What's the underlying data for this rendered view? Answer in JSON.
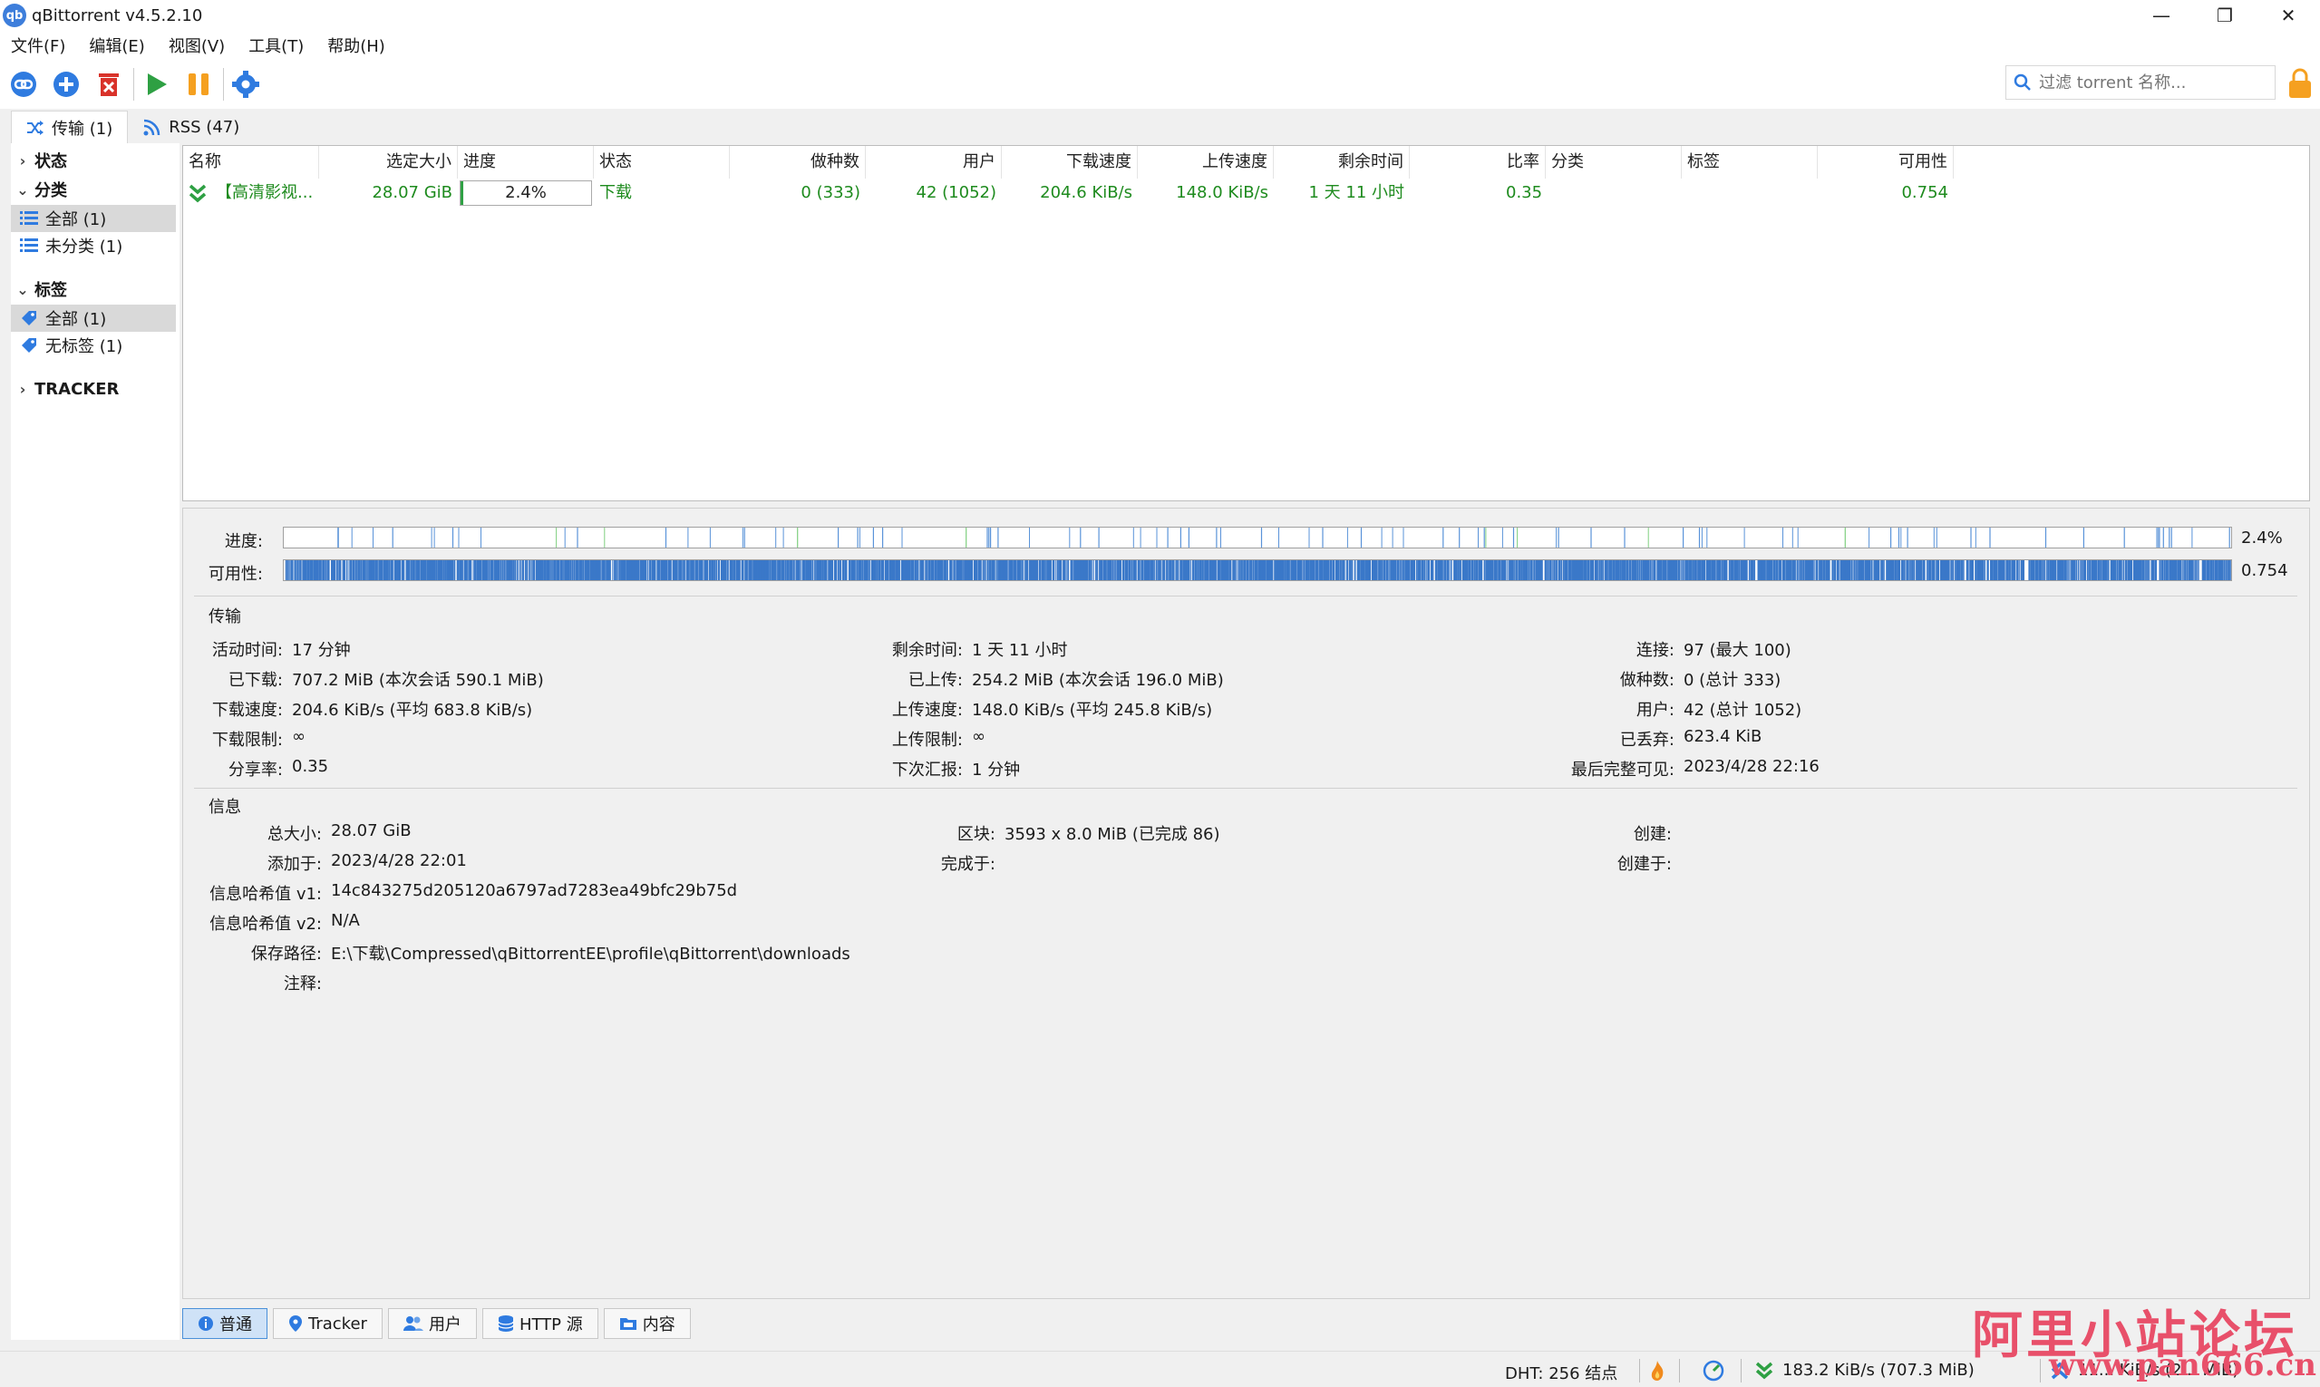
{
  "window": {
    "title": "qBittorrent v4.5.2.10",
    "icon_text": "qb"
  },
  "menu": [
    "文件(F)",
    "编辑(E)",
    "视图(V)",
    "工具(T)",
    "帮助(H)"
  ],
  "search": {
    "placeholder": "过滤 torrent 名称..."
  },
  "top_tabs": [
    {
      "label": "传输 (1)"
    },
    {
      "label": "RSS (47)"
    }
  ],
  "sidebar": {
    "status_header": "状态",
    "category_header": "分类",
    "category_items": [
      "全部 (1)",
      "未分类 (1)"
    ],
    "tag_header": "标签",
    "tag_items": [
      "全部 (1)",
      "无标签 (1)"
    ],
    "tracker_header": "TRACKER"
  },
  "table": {
    "columns": [
      "名称",
      "选定大小",
      "进度",
      "状态",
      "做种数",
      "用户",
      "下载速度",
      "上传速度",
      "剩余时间",
      "比率",
      "分类",
      "标签",
      "可用性"
    ],
    "row": {
      "name": "【高清影视...",
      "size": "28.07 GiB",
      "progress_text": "2.4%",
      "progress": 0.024,
      "status": "下载",
      "seeds": "0 (333)",
      "peers": "42 (1052)",
      "dl_speed": "204.6 KiB/s",
      "ul_speed": "148.0 KiB/s",
      "eta": "1 天 11 小时",
      "ratio": "0.35",
      "category": "",
      "tags": "",
      "availability": "0.754"
    }
  },
  "bars": {
    "progress_label": "进度:",
    "progress_value": "2.4%",
    "availability_label": "可用性:",
    "availability_value": "0.754"
  },
  "transfer": {
    "title": "传输",
    "col1": [
      {
        "label": "活动时间:",
        "value": "17 分钟"
      },
      {
        "label": "已下载:",
        "value": "707.2 MiB (本次会话 590.1 MiB)"
      },
      {
        "label": "下载速度:",
        "value": "204.6 KiB/s (平均 683.8 KiB/s)"
      },
      {
        "label": "下载限制:",
        "value": "∞"
      },
      {
        "label": "分享率:",
        "value": "0.35"
      }
    ],
    "col2": [
      {
        "label": "剩余时间:",
        "value": "1 天 11 小时"
      },
      {
        "label": "已上传:",
        "value": "254.2 MiB (本次会话 196.0 MiB)"
      },
      {
        "label": "上传速度:",
        "value": "148.0 KiB/s (平均 245.8 KiB/s)"
      },
      {
        "label": "上传限制:",
        "value": "∞"
      },
      {
        "label": "下次汇报:",
        "value": "1 分钟"
      }
    ],
    "col3": [
      {
        "label": "连接:",
        "value": "97 (最大 100)"
      },
      {
        "label": "做种数:",
        "value": "0 (总计 333)"
      },
      {
        "label": "用户:",
        "value": "42 (总计 1052)"
      },
      {
        "label": "已丢弃:",
        "value": "623.4 KiB"
      },
      {
        "label": "最后完整可见:",
        "value": "2023/4/28 22:16"
      }
    ]
  },
  "info": {
    "title": "信息",
    "col1": [
      {
        "label": "总大小:",
        "value": "28.07 GiB"
      },
      {
        "label": "添加于:",
        "value": "2023/4/28 22:01"
      },
      {
        "label": "信息哈希值 v1:",
        "value": "14c843275d205120a6797ad7283ea49bfc29b75d"
      },
      {
        "label": "信息哈希值 v2:",
        "value": "N/A"
      },
      {
        "label": "保存路径:",
        "value": "E:\\下载\\Compressed\\qBittorrentEE\\profile\\qBittorrent\\downloads"
      },
      {
        "label": "注释:",
        "value": ""
      }
    ],
    "col2": [
      {
        "label": "区块:",
        "value": "3593 x 8.0 MiB (已完成 86)"
      },
      {
        "label": "完成于:",
        "value": ""
      }
    ],
    "col3": [
      {
        "label": "创建:",
        "value": ""
      },
      {
        "label": "创建于:",
        "value": ""
      }
    ]
  },
  "bottom_tabs": [
    "普通",
    "Tracker",
    "用户",
    "HTTP 源",
    "内容"
  ],
  "statusbar": {
    "dht": "DHT: 256 结点",
    "download": "183.2 KiB/s (707.3 MiB)",
    "upload": "11... KiB/s (2... MiB)"
  },
  "watermark": {
    "line1": "阿里小站论坛",
    "line2": "www.pan666.cn"
  },
  "colors": {
    "accent": "#3d7edb",
    "green": "#1e8b1e",
    "bar_blue": "#3a78c9",
    "red": "#d9322a",
    "orange": "#f5a020"
  }
}
